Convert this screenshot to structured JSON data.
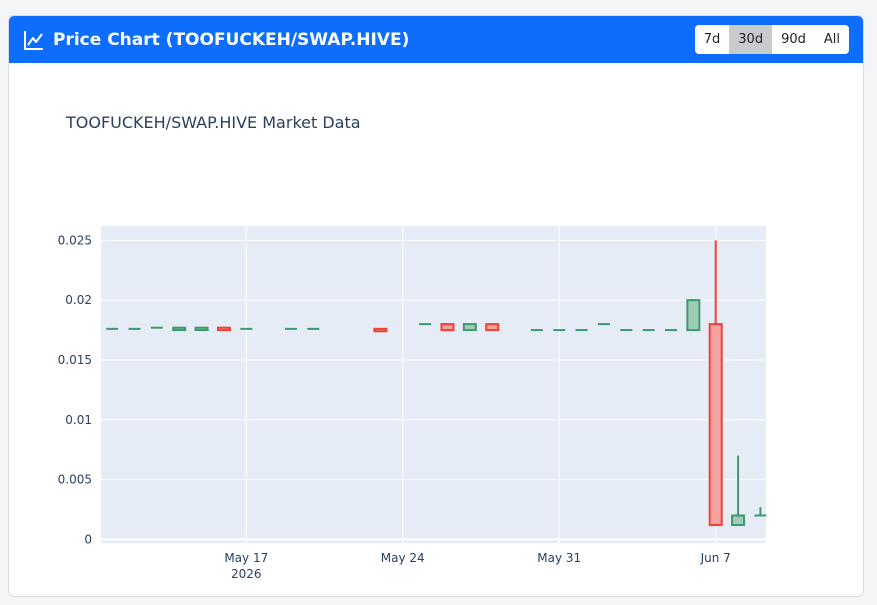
{
  "header": {
    "title": "Price Chart (TOOFUCKEH/SWAP.HIVE)",
    "ranges": [
      {
        "label": "7d",
        "active": false
      },
      {
        "label": "30d",
        "active": true
      },
      {
        "label": "90d",
        "active": false
      },
      {
        "label": "All",
        "active": false
      }
    ],
    "icon": "line-chart-icon"
  },
  "colors": {
    "accent": "#0d6efd",
    "up": "#3d9970",
    "down": "#ef4136",
    "up_fill": "#9fcdb4",
    "down_fill": "#f5a3a0",
    "plot_bg": "#e5ecf6"
  },
  "chart_data": {
    "type": "candlestick",
    "title": "TOOFUCKEH/SWAP.HIVE Market Data",
    "xlabel": "",
    "ylabel": "",
    "x_tick_labels": [
      {
        "date": "2026-05-17",
        "label": "May 17",
        "sublabel": "2026"
      },
      {
        "date": "2026-05-24",
        "label": "May 24",
        "sublabel": ""
      },
      {
        "date": "2026-05-31",
        "label": "May 31",
        "sublabel": ""
      },
      {
        "date": "2026-06-07",
        "label": "Jun 7",
        "sublabel": ""
      }
    ],
    "y_tick_labels": [
      "0",
      "0.005",
      "0.01",
      "0.015",
      "0.02",
      "0.025"
    ],
    "xlim": [
      "2026-05-10T12:00",
      "2026-06-09T06:00"
    ],
    "ylim": [
      -0.0003,
      0.0262
    ],
    "grid": true,
    "candles": [
      {
        "date": "2026-05-11",
        "open": 0.0176,
        "high": 0.0176,
        "low": 0.0176,
        "close": 0.0176
      },
      {
        "date": "2026-05-12",
        "open": 0.0176,
        "high": 0.0176,
        "low": 0.0176,
        "close": 0.0176
      },
      {
        "date": "2026-05-13",
        "open": 0.0177,
        "high": 0.0177,
        "low": 0.0177,
        "close": 0.0177
      },
      {
        "date": "2026-05-14",
        "open": 0.0175,
        "high": 0.0177,
        "low": 0.0175,
        "close": 0.0177
      },
      {
        "date": "2026-05-15",
        "open": 0.0175,
        "high": 0.0177,
        "low": 0.0175,
        "close": 0.0177
      },
      {
        "date": "2026-05-16",
        "open": 0.0177,
        "high": 0.0177,
        "low": 0.0175,
        "close": 0.0175
      },
      {
        "date": "2026-05-17",
        "open": 0.0176,
        "high": 0.0176,
        "low": 0.0176,
        "close": 0.0176
      },
      {
        "date": "2026-05-19",
        "open": 0.0176,
        "high": 0.0176,
        "low": 0.0176,
        "close": 0.0176
      },
      {
        "date": "2026-05-20",
        "open": 0.0176,
        "high": 0.0176,
        "low": 0.0176,
        "close": 0.0176
      },
      {
        "date": "2026-05-23",
        "open": 0.0176,
        "high": 0.0176,
        "low": 0.0174,
        "close": 0.0174
      },
      {
        "date": "2026-05-25",
        "open": 0.018,
        "high": 0.018,
        "low": 0.018,
        "close": 0.018
      },
      {
        "date": "2026-05-26",
        "open": 0.018,
        "high": 0.018,
        "low": 0.0175,
        "close": 0.0175
      },
      {
        "date": "2026-05-27",
        "open": 0.0175,
        "high": 0.018,
        "low": 0.0175,
        "close": 0.018
      },
      {
        "date": "2026-05-28",
        "open": 0.018,
        "high": 0.018,
        "low": 0.0175,
        "close": 0.0175
      },
      {
        "date": "2026-05-30",
        "open": 0.0175,
        "high": 0.0175,
        "low": 0.0175,
        "close": 0.0175
      },
      {
        "date": "2026-05-31",
        "open": 0.0175,
        "high": 0.0175,
        "low": 0.0175,
        "close": 0.0175
      },
      {
        "date": "2026-06-01",
        "open": 0.0175,
        "high": 0.0175,
        "low": 0.0175,
        "close": 0.0175
      },
      {
        "date": "2026-06-02",
        "open": 0.018,
        "high": 0.018,
        "low": 0.018,
        "close": 0.018
      },
      {
        "date": "2026-06-03",
        "open": 0.0175,
        "high": 0.0175,
        "low": 0.0175,
        "close": 0.0175
      },
      {
        "date": "2026-06-04",
        "open": 0.0175,
        "high": 0.0175,
        "low": 0.0175,
        "close": 0.0175
      },
      {
        "date": "2026-06-05",
        "open": 0.0175,
        "high": 0.0175,
        "low": 0.0175,
        "close": 0.0175
      },
      {
        "date": "2026-06-06",
        "open": 0.0175,
        "high": 0.02,
        "low": 0.0175,
        "close": 0.02
      },
      {
        "date": "2026-06-07",
        "open": 0.018,
        "high": 0.025,
        "low": 0.0012,
        "close": 0.0012
      },
      {
        "date": "2026-06-08",
        "open": 0.0012,
        "high": 0.007,
        "low": 0.0012,
        "close": 0.002
      },
      {
        "date": "2026-06-09",
        "open": 0.002,
        "high": 0.0027,
        "low": 0.002,
        "close": 0.002
      }
    ]
  }
}
